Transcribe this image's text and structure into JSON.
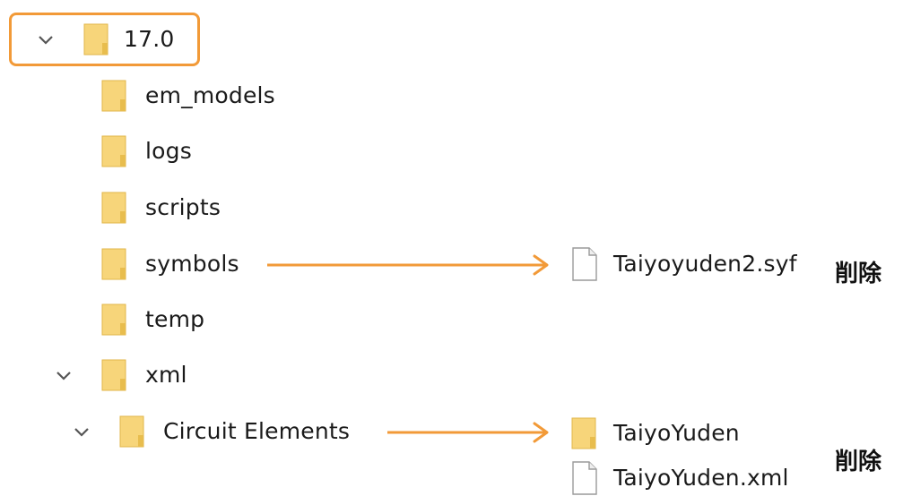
{
  "tree": {
    "root": {
      "label": "17.0",
      "expanded": true
    },
    "children": [
      {
        "label": "em_models"
      },
      {
        "label": "logs"
      },
      {
        "label": "scripts"
      },
      {
        "label": "symbols"
      },
      {
        "label": "temp"
      },
      {
        "label": "xml",
        "expanded": true
      },
      {
        "label": "Circuit Elements",
        "expanded": true
      }
    ]
  },
  "symbols_targets": {
    "file": {
      "label": "Taiyoyuden2.syf",
      "icon": "file-icon"
    },
    "note": "削除"
  },
  "circuit_targets": {
    "folder": {
      "label": "TaiyoYuden",
      "icon": "folder-icon"
    },
    "file": {
      "label": "TaiyoYuden.xml",
      "icon": "file-icon"
    },
    "note": "削除"
  },
  "colors": {
    "highlight": "#f29a38",
    "arrow": "#f29a38",
    "folder_fill": "#f7d57a",
    "folder_shade": "#e8bd4e"
  }
}
